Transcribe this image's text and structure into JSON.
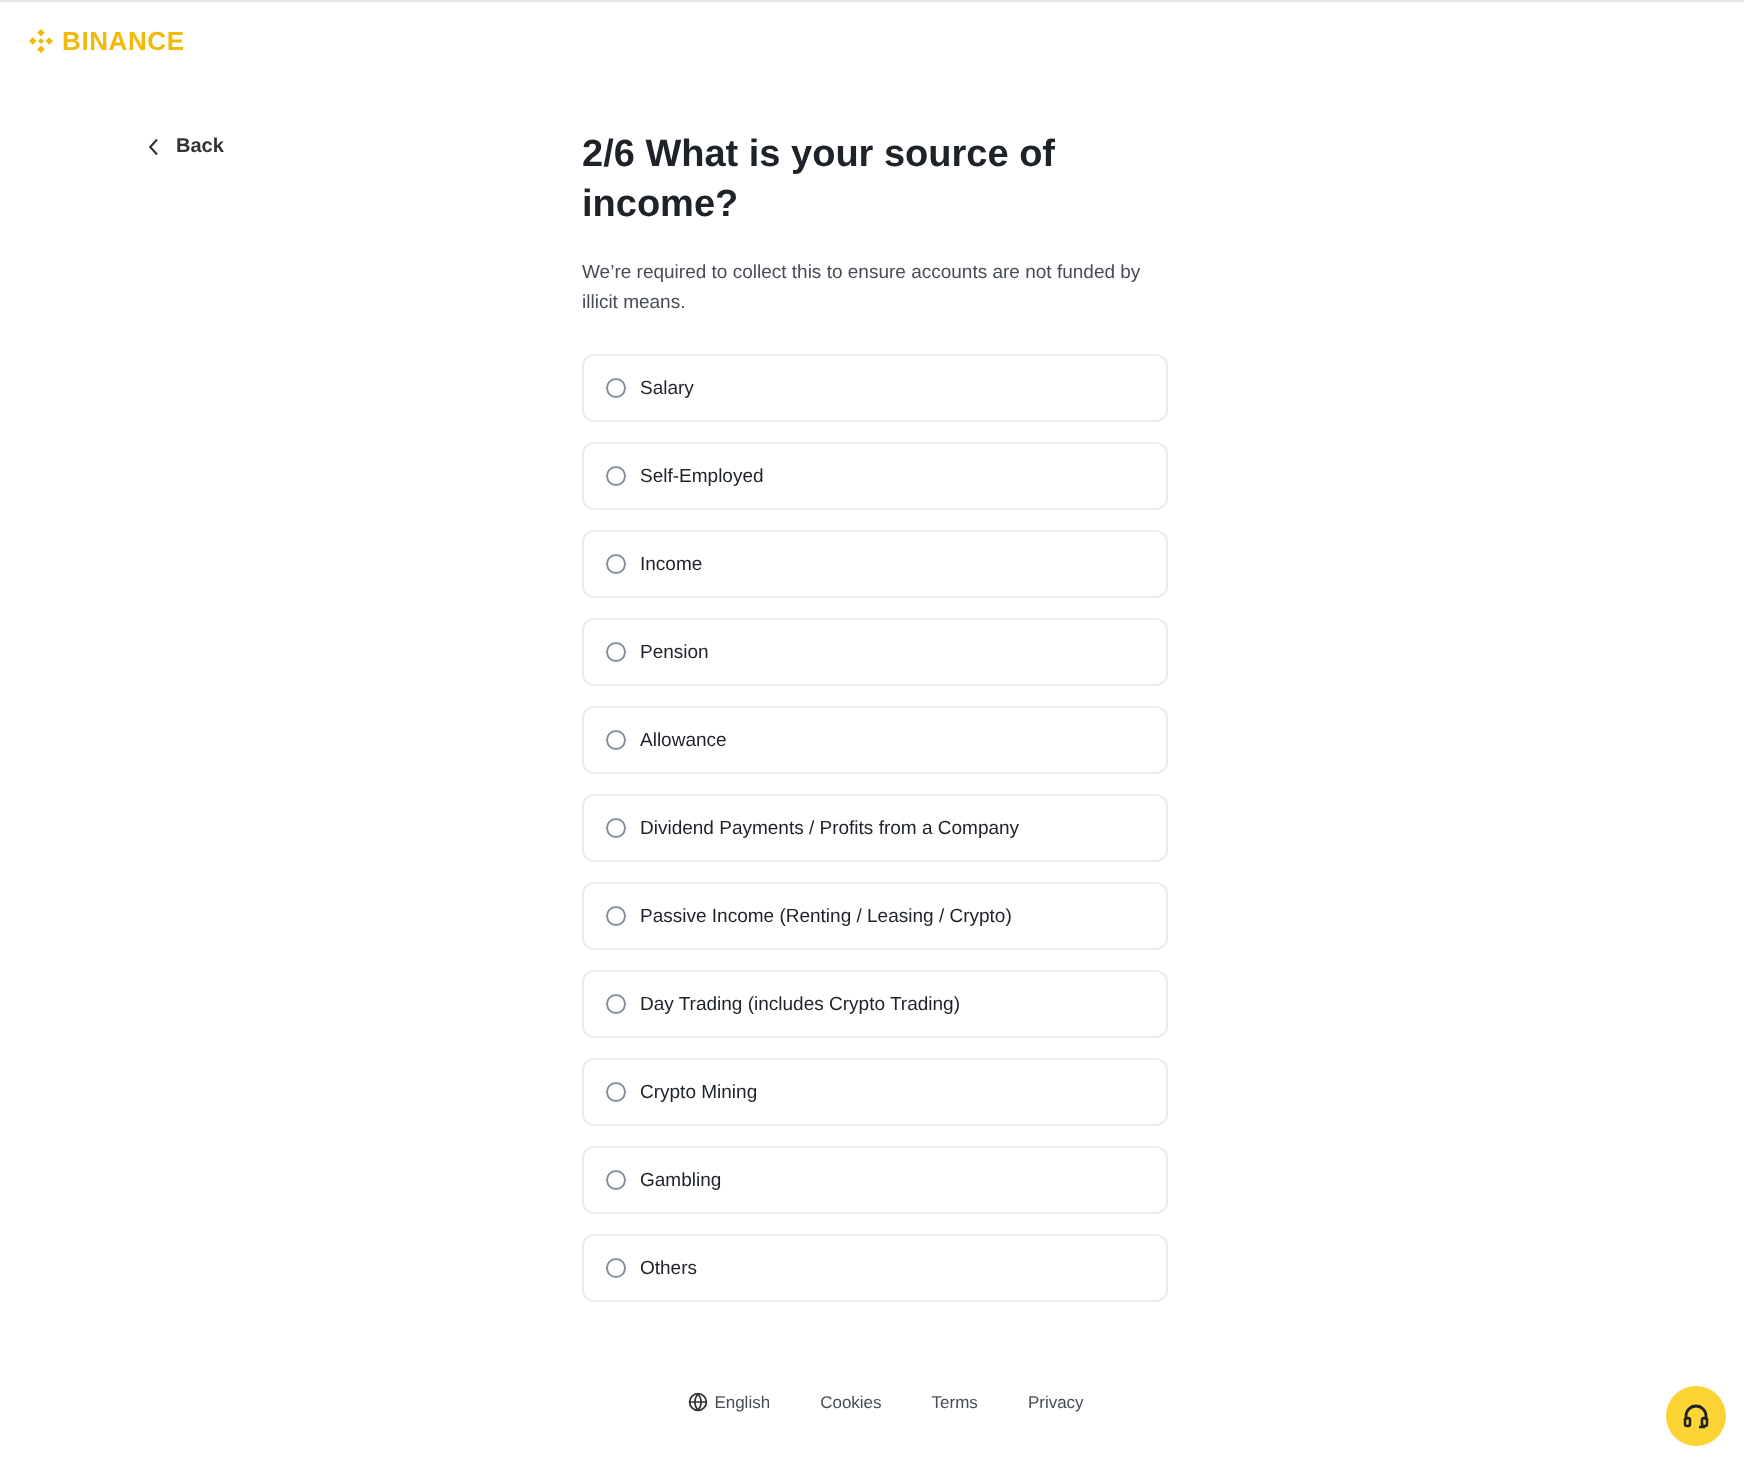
{
  "logo": {
    "text": "BINANCE"
  },
  "back": {
    "label": "Back"
  },
  "title": "2/6 What is your source of income?",
  "subtitle": "We’re required to collect this to ensure accounts are not funded by illicit means.",
  "options": [
    {
      "label": "Salary",
      "selected": false
    },
    {
      "label": "Self-Employed",
      "selected": false
    },
    {
      "label": "Income",
      "selected": false
    },
    {
      "label": "Pension",
      "selected": false
    },
    {
      "label": "Allowance",
      "selected": false
    },
    {
      "label": "Dividend Payments / Profits from a Company",
      "selected": false
    },
    {
      "label": "Passive Income (Renting / Leasing / Crypto)",
      "selected": false
    },
    {
      "label": "Day Trading (includes Crypto Trading)",
      "selected": false
    },
    {
      "label": "Crypto Mining",
      "selected": false
    },
    {
      "label": "Gambling",
      "selected": false
    },
    {
      "label": "Others",
      "selected": false
    }
  ],
  "footer": {
    "language": "English",
    "links": [
      "Cookies",
      "Terms",
      "Privacy"
    ]
  }
}
